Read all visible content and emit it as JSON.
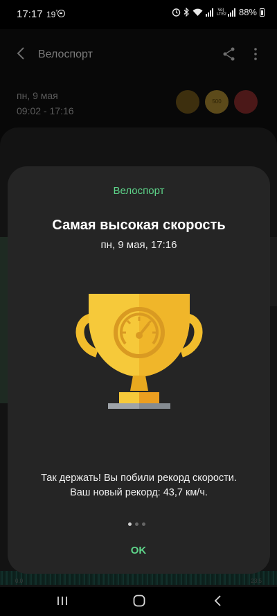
{
  "status_bar": {
    "time": "17:17",
    "temperature": "19",
    "degree": "°",
    "battery_percent": "88%",
    "network_label": "Vo) LTE2"
  },
  "header": {
    "title": "Велоспорт",
    "icons": [
      "back-icon",
      "share-icon",
      "more-vert-icon"
    ]
  },
  "session": {
    "date": "пн, 9 мая",
    "time_range": "09:02 - 17:16",
    "badges": [
      "trophy-badge",
      "500-badge",
      "flag-badge"
    ],
    "badge_500_label": "500"
  },
  "chart": {
    "axis_left": "0.0",
    "axis_right": "23:5"
  },
  "dialog": {
    "category": "Велоспорт",
    "title": "Самая высокая скорость",
    "date": "пн, 9 мая, 17:16",
    "message_line1": "Так держать! Вы побили рекорд скорости.",
    "message_line2": "Ваш новый рекорд: 43,7 км/ч.",
    "page_indicator": {
      "total": 3,
      "current": 1
    },
    "ok_label": "OK"
  },
  "nav_bar": {
    "icons": [
      "recents-icon",
      "home-icon",
      "back-nav-icon"
    ]
  },
  "colors": {
    "accent_green": "#5ed58a",
    "dialog_bg": "#252525",
    "trophy_gold": "#f5c232"
  }
}
